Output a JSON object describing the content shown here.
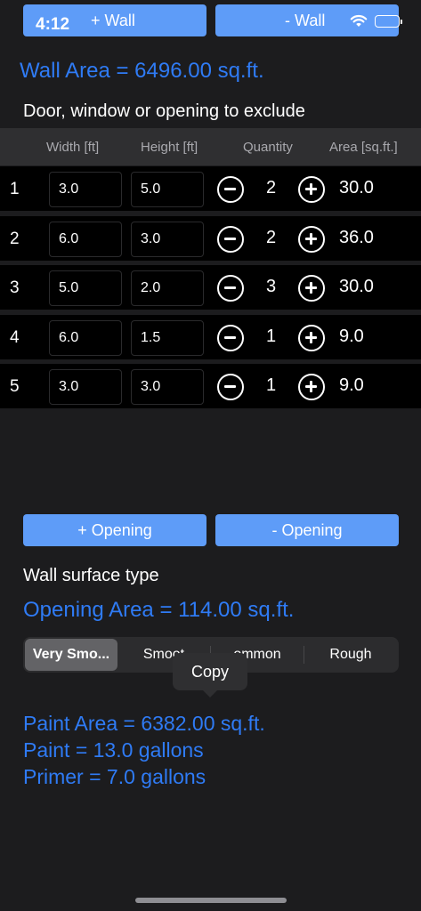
{
  "status": {
    "time": "4:12"
  },
  "wall_buttons": {
    "add": "+ Wall",
    "remove": "- Wall"
  },
  "wall_area": "Wall Area = 6496.00 sq.ft.",
  "exclude_label": "Door, window or opening to exclude",
  "table": {
    "headers": {
      "width": "Width [ft]",
      "height": "Height [ft]",
      "quantity": "Quantity",
      "area": "Area [sq.ft.]"
    },
    "rows": [
      {
        "num": "1",
        "width": "3.0",
        "height": "5.0",
        "qty": "2",
        "area": "30.0"
      },
      {
        "num": "2",
        "width": "6.0",
        "height": "3.0",
        "qty": "2",
        "area": "36.0"
      },
      {
        "num": "3",
        "width": "5.0",
        "height": "2.0",
        "qty": "3",
        "area": "30.0"
      },
      {
        "num": "4",
        "width": "6.0",
        "height": "1.5",
        "qty": "1",
        "area": "9.0"
      },
      {
        "num": "5",
        "width": "3.0",
        "height": "3.0",
        "qty": "1",
        "area": "9.0"
      }
    ]
  },
  "opening_buttons": {
    "add": "+ Opening",
    "remove": "- Opening"
  },
  "surface_label": "Wall surface type",
  "opening_area": "Opening Area = 114.00 sq.ft.",
  "surface_options": [
    "Very Smo...",
    "Smoot",
    "ommon",
    "Rough"
  ],
  "copy_label": "Copy",
  "results": {
    "paint_area": "Paint Area = 6382.00 sq.ft.",
    "paint": "Paint = 13.0 gallons",
    "primer": "Primer = 7.0 gallons"
  }
}
